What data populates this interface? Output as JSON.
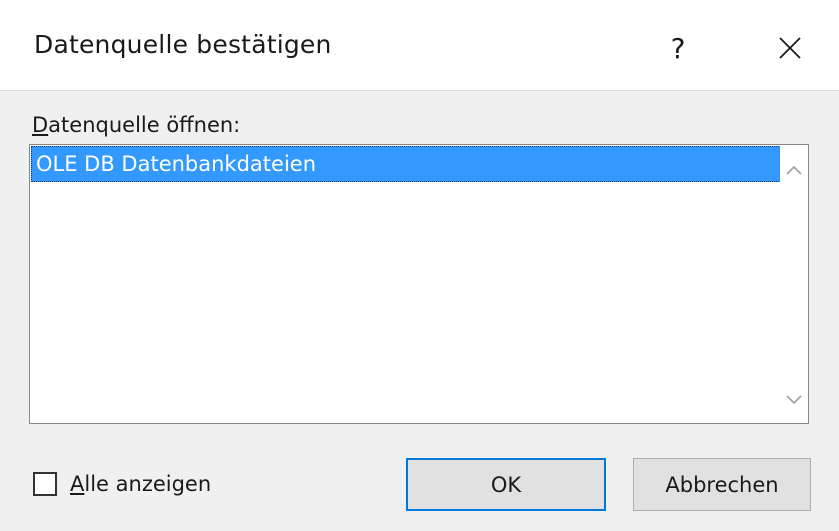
{
  "dialog": {
    "title": "Datenquelle bestätigen",
    "help_label": "?",
    "close_icon": "close-icon"
  },
  "list": {
    "label_accesskey": "D",
    "label_rest": "atenquelle öffnen:",
    "items": [
      {
        "label": "OLE DB Datenbankdateien",
        "selected": true
      }
    ]
  },
  "options": {
    "show_all_accesskey": "A",
    "show_all_rest": "lle anzeigen",
    "show_all_checked": false
  },
  "buttons": {
    "ok_label": "OK",
    "cancel_label": "Abbrechen"
  },
  "colors": {
    "selection": "#3399ff",
    "default_button_border": "#0078d7",
    "background": "#f0f0f0"
  }
}
